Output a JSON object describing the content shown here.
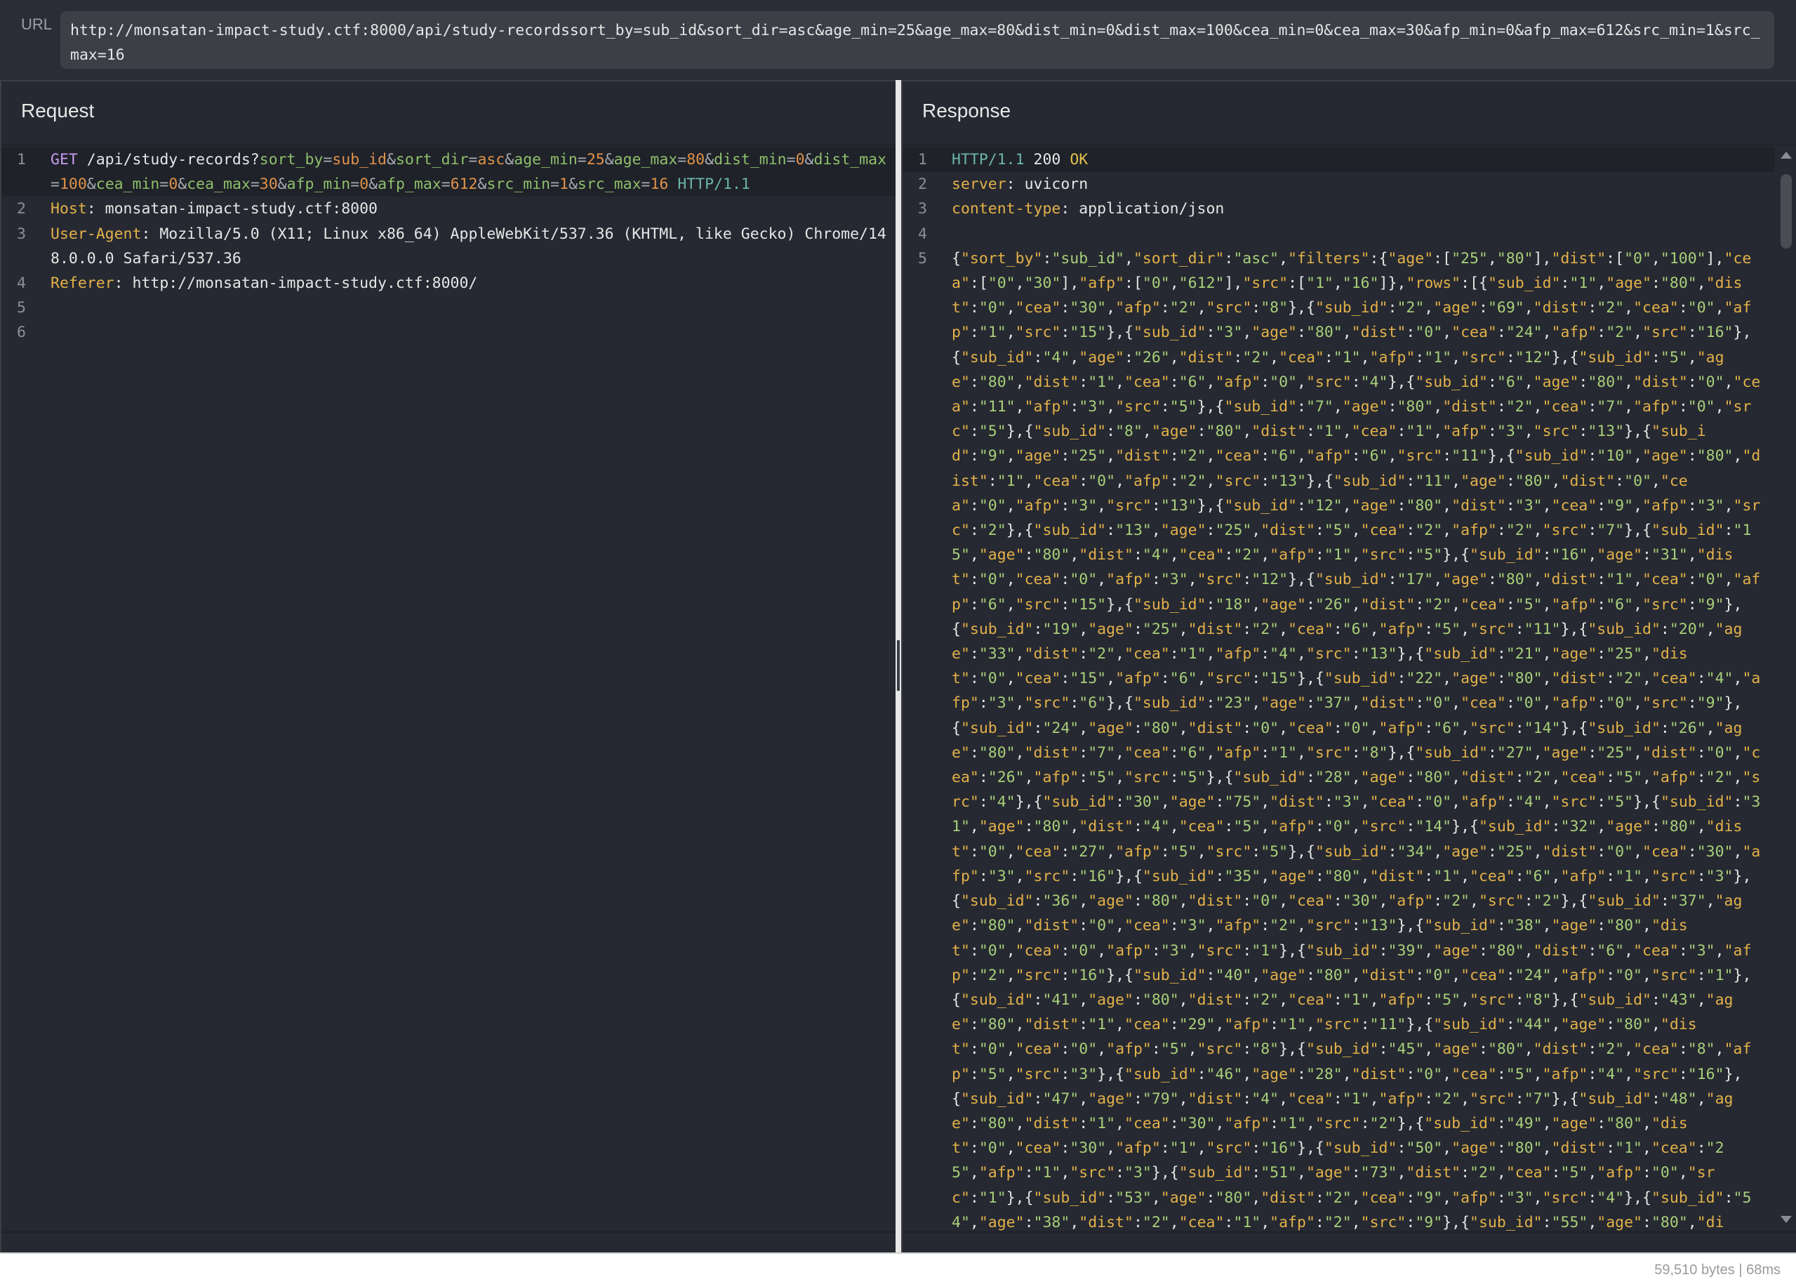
{
  "url_bar": {
    "label": "URL",
    "value": "http://monsatan-impact-study.ctf:8000/api/study-recordssort_by=sub_id&sort_dir=asc&age_min=25&age_max=80&dist_min=0&dist_max=100&cea_min=0&cea_max=30&afp_min=0&afp_max=612&src_min=1&src_max=16"
  },
  "request": {
    "title": "Request",
    "line_numbers": [
      "1",
      "2",
      "3",
      "4",
      "5",
      "6"
    ],
    "method": "GET",
    "path": "/api/study-records?",
    "params": [
      {
        "name": "sort_by",
        "value": "sub_id"
      },
      {
        "name": "sort_dir",
        "value": "asc"
      },
      {
        "name": "age_min",
        "value": "25"
      },
      {
        "name": "age_max",
        "value": "80"
      },
      {
        "name": "dist_min",
        "value": "0"
      },
      {
        "name": "dist_max",
        "value": "100"
      },
      {
        "name": "cea_min",
        "value": "0"
      },
      {
        "name": "cea_max",
        "value": "30"
      },
      {
        "name": "afp_min",
        "value": "0"
      },
      {
        "name": "afp_max",
        "value": "612"
      },
      {
        "name": "src_min",
        "value": "1"
      },
      {
        "name": "src_max",
        "value": "16"
      }
    ],
    "protocol": "HTTP/1.1",
    "headers": [
      {
        "name": "Host",
        "value": "monsatan-impact-study.ctf:8000"
      },
      {
        "name": "User-Agent",
        "value": "Mozilla/5.0 (X11; Linux x86_64) AppleWebKit/537.36 (KHTML, like Gecko) Chrome/148.0.0.0 Safari/537.36"
      },
      {
        "name": "Referer",
        "value": "http://monsatan-impact-study.ctf:8000/"
      }
    ]
  },
  "response": {
    "title": "Response",
    "line_numbers": [
      "1",
      "2",
      "3",
      "4",
      "5"
    ],
    "protocol": "HTTP/1.1",
    "status_code": "200",
    "status_text": "OK",
    "headers": [
      {
        "name": "server",
        "value": "uvicorn"
      },
      {
        "name": "content-type",
        "value": "application/json"
      }
    ],
    "body": {
      "sort_by": "sub_id",
      "sort_dir": "asc",
      "filters": {
        "age": [
          "25",
          "80"
        ],
        "dist": [
          "0",
          "100"
        ],
        "cea": [
          "0",
          "30"
        ],
        "afp": [
          "0",
          "612"
        ],
        "src": [
          "1",
          "16"
        ]
      },
      "rows": [
        {
          "sub_id": "1",
          "age": "80",
          "dist": "0",
          "cea": "30",
          "afp": "2",
          "src": "8"
        },
        {
          "sub_id": "2",
          "age": "69",
          "dist": "2",
          "cea": "0",
          "afp": "1",
          "src": "15"
        },
        {
          "sub_id": "3",
          "age": "80",
          "dist": "0",
          "cea": "24",
          "afp": "2",
          "src": "16"
        },
        {
          "sub_id": "4",
          "age": "26",
          "dist": "2",
          "cea": "1",
          "afp": "1",
          "src": "12"
        },
        {
          "sub_id": "5",
          "age": "80",
          "dist": "1",
          "cea": "6",
          "afp": "0",
          "src": "4"
        },
        {
          "sub_id": "6",
          "age": "80",
          "dist": "0",
          "cea": "11",
          "afp": "3",
          "src": "5"
        },
        {
          "sub_id": "7",
          "age": "80",
          "dist": "2",
          "cea": "7",
          "afp": "0",
          "src": "5"
        },
        {
          "sub_id": "8",
          "age": "80",
          "dist": "1",
          "cea": "1",
          "afp": "3",
          "src": "13"
        },
        {
          "sub_id": "9",
          "age": "25",
          "dist": "2",
          "cea": "6",
          "afp": "6",
          "src": "11"
        },
        {
          "sub_id": "10",
          "age": "80",
          "dist": "1",
          "cea": "0",
          "afp": "2",
          "src": "13"
        },
        {
          "sub_id": "11",
          "age": "80",
          "dist": "0",
          "cea": "0",
          "afp": "3",
          "src": "13"
        },
        {
          "sub_id": "12",
          "age": "80",
          "dist": "3",
          "cea": "9",
          "afp": "3",
          "src": "2"
        },
        {
          "sub_id": "13",
          "age": "25",
          "dist": "5",
          "cea": "2",
          "afp": "2",
          "src": "7"
        },
        {
          "sub_id": "15",
          "age": "80",
          "dist": "4",
          "cea": "2",
          "afp": "1",
          "src": "5"
        },
        {
          "sub_id": "16",
          "age": "31",
          "dist": "0",
          "cea": "0",
          "afp": "3",
          "src": "12"
        },
        {
          "sub_id": "17",
          "age": "80",
          "dist": "1",
          "cea": "0",
          "afp": "6",
          "src": "15"
        },
        {
          "sub_id": "18",
          "age": "26",
          "dist": "2",
          "cea": "5",
          "afp": "6",
          "src": "9"
        },
        {
          "sub_id": "19",
          "age": "25",
          "dist": "2",
          "cea": "6",
          "afp": "5",
          "src": "11"
        },
        {
          "sub_id": "20",
          "age": "33",
          "dist": "2",
          "cea": "1",
          "afp": "4",
          "src": "13"
        },
        {
          "sub_id": "21",
          "age": "25",
          "dist": "0",
          "cea": "15",
          "afp": "6",
          "src": "15"
        },
        {
          "sub_id": "22",
          "age": "80",
          "dist": "2",
          "cea": "4",
          "afp": "3",
          "src": "6"
        },
        {
          "sub_id": "23",
          "age": "37",
          "dist": "0",
          "cea": "0",
          "afp": "0",
          "src": "9"
        },
        {
          "sub_id": "24",
          "age": "80",
          "dist": "0",
          "cea": "0",
          "afp": "6",
          "src": "14"
        },
        {
          "sub_id": "26",
          "age": "80",
          "dist": "7",
          "cea": "6",
          "afp": "1",
          "src": "8"
        },
        {
          "sub_id": "27",
          "age": "25",
          "dist": "0",
          "cea": "26",
          "afp": "5",
          "src": "5"
        },
        {
          "sub_id": "28",
          "age": "80",
          "dist": "2",
          "cea": "5",
          "afp": "2",
          "src": "4"
        },
        {
          "sub_id": "30",
          "age": "75",
          "dist": "3",
          "cea": "0",
          "afp": "4",
          "src": "5"
        },
        {
          "sub_id": "31",
          "age": "80",
          "dist": "4",
          "cea": "5",
          "afp": "0",
          "src": "14"
        },
        {
          "sub_id": "32",
          "age": "80",
          "dist": "0",
          "cea": "27",
          "afp": "5",
          "src": "5"
        },
        {
          "sub_id": "34",
          "age": "25",
          "dist": "0",
          "cea": "30",
          "afp": "3",
          "src": "16"
        },
        {
          "sub_id": "35",
          "age": "80",
          "dist": "1",
          "cea": "6",
          "afp": "1",
          "src": "3"
        },
        {
          "sub_id": "36",
          "age": "80",
          "dist": "0",
          "cea": "30",
          "afp": "2",
          "src": "2"
        },
        {
          "sub_id": "37",
          "age": "80",
          "dist": "0",
          "cea": "3",
          "afp": "2",
          "src": "13"
        },
        {
          "sub_id": "38",
          "age": "80",
          "dist": "0",
          "cea": "0",
          "afp": "3",
          "src": "1"
        },
        {
          "sub_id": "39",
          "age": "80",
          "dist": "6",
          "cea": "3",
          "afp": "2",
          "src": "16"
        },
        {
          "sub_id": "40",
          "age": "80",
          "dist": "0",
          "cea": "24",
          "afp": "0",
          "src": "1"
        },
        {
          "sub_id": "41",
          "age": "80",
          "dist": "2",
          "cea": "1",
          "afp": "5",
          "src": "8"
        },
        {
          "sub_id": "43",
          "age": "80",
          "dist": "1",
          "cea": "29",
          "afp": "1",
          "src": "11"
        },
        {
          "sub_id": "44",
          "age": "80",
          "dist": "0",
          "cea": "0",
          "afp": "5",
          "src": "8"
        },
        {
          "sub_id": "45",
          "age": "80",
          "dist": "2",
          "cea": "8",
          "afp": "5",
          "src": "3"
        },
        {
          "sub_id": "46",
          "age": "28",
          "dist": "0",
          "cea": "5",
          "afp": "4",
          "src": "16"
        },
        {
          "sub_id": "47",
          "age": "79",
          "dist": "4",
          "cea": "1",
          "afp": "2",
          "src": "7"
        },
        {
          "sub_id": "48",
          "age": "80",
          "dist": "1",
          "cea": "30",
          "afp": "1",
          "src": "2"
        },
        {
          "sub_id": "49",
          "age": "80",
          "dist": "0",
          "cea": "30",
          "afp": "1",
          "src": "16"
        },
        {
          "sub_id": "50",
          "age": "80",
          "dist": "1",
          "cea": "25",
          "afp": "1",
          "src": "3"
        },
        {
          "sub_id": "51",
          "age": "73",
          "dist": "2",
          "cea": "5",
          "afp": "0",
          "src": "1"
        },
        {
          "sub_id": "53",
          "age": "80",
          "dist": "2",
          "cea": "9",
          "afp": "3",
          "src": "4"
        },
        {
          "sub_id": "54",
          "age": "38",
          "dist": "2",
          "cea": "1",
          "afp": "2",
          "src": "9"
        },
        {
          "sub_id": "55",
          "age": "80",
          "dis": ""
        }
      ]
    }
  },
  "status_bar": {
    "text": "59,510 bytes | 68ms"
  }
}
